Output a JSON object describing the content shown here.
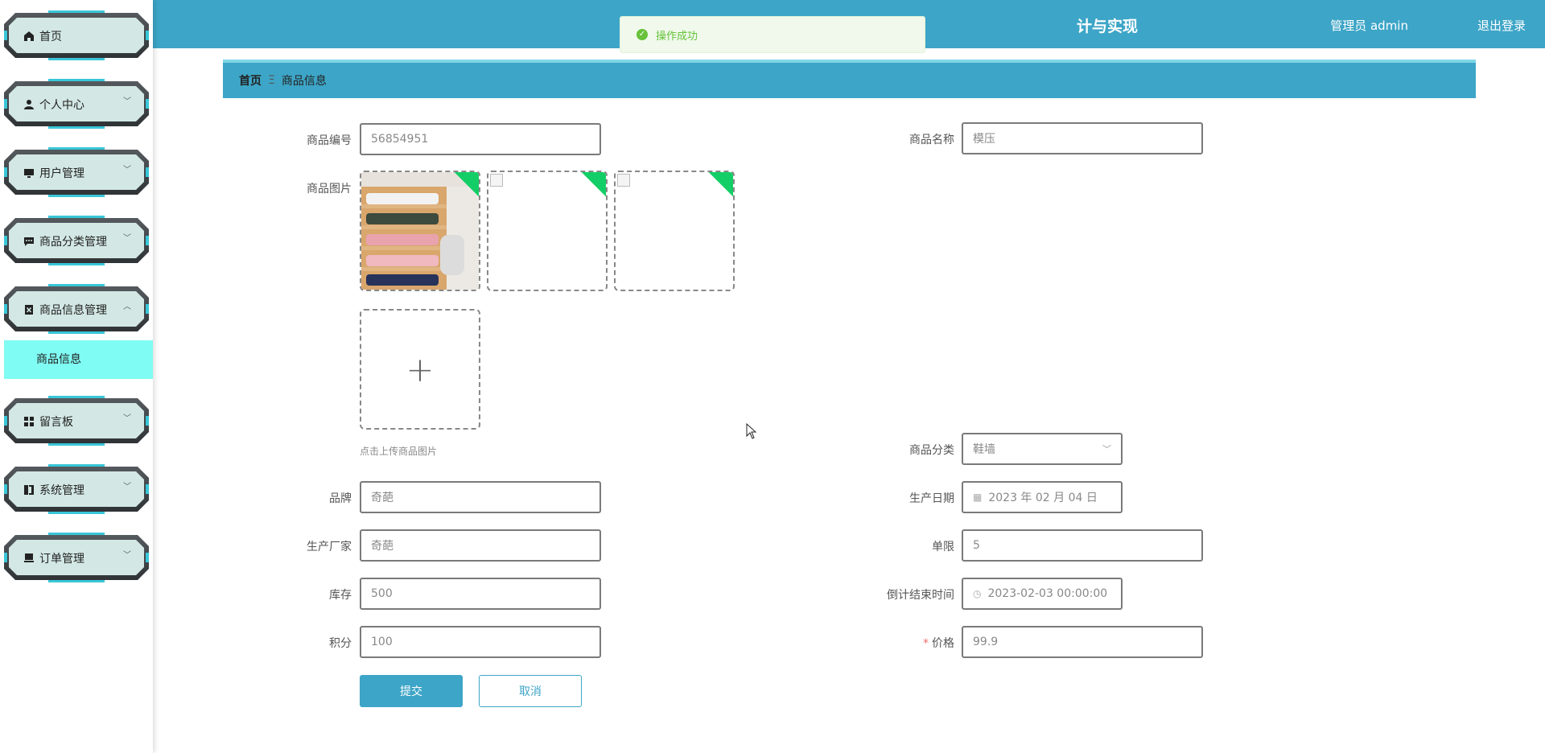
{
  "header": {
    "title_fragment": "计与实现",
    "user": "管理员 admin",
    "logout": "退出登录"
  },
  "toast": {
    "text": "操作成功"
  },
  "sidebar": {
    "items": [
      {
        "label": "首页",
        "icon": "home-icon"
      },
      {
        "label": "个人中心",
        "icon": "user-icon"
      },
      {
        "label": "用户管理",
        "icon": "monitor-icon"
      },
      {
        "label": "商品分类管理",
        "icon": "chat-icon"
      },
      {
        "label": "商品信息管理",
        "icon": "clipboard-icon"
      },
      {
        "label": "留言板",
        "icon": "grid-icon"
      },
      {
        "label": "系统管理",
        "icon": "book-icon"
      },
      {
        "label": "订单管理",
        "icon": "cart-icon"
      }
    ],
    "submenu": {
      "label": "商品信息"
    }
  },
  "breadcrumb": {
    "home": "首页",
    "separator": "Ξ",
    "current": "商品信息"
  },
  "form": {
    "code_label": "商品编号",
    "code_value": "56854951",
    "name_label": "商品名称",
    "name_value": "模压",
    "image_label": "商品图片",
    "upload_tip": "点击上传商品图片",
    "category_label": "商品分类",
    "category_value": "鞋墙",
    "brand_label": "品牌",
    "brand_value": "奇葩",
    "date_label": "生产日期",
    "date_value": "2023 年 02 月 04 日",
    "maker_label": "生产厂家",
    "maker_value": "奇葩",
    "limit_label": "单限",
    "limit_value": "5",
    "stock_label": "库存",
    "stock_value": "500",
    "countdown_label": "倒计结束时间",
    "countdown_value": "2023-02-03 00:00:00",
    "points_label": "积分",
    "points_value": "100",
    "price_required": "*",
    "price_label": "价格",
    "price_value": "99.9",
    "submit": "提交",
    "cancel": "取消"
  },
  "colors": {
    "primary": "#3da5c7",
    "success": "#67c23a",
    "submenu_bg": "#7ffcf3",
    "corner_badge": "#13ce66"
  }
}
